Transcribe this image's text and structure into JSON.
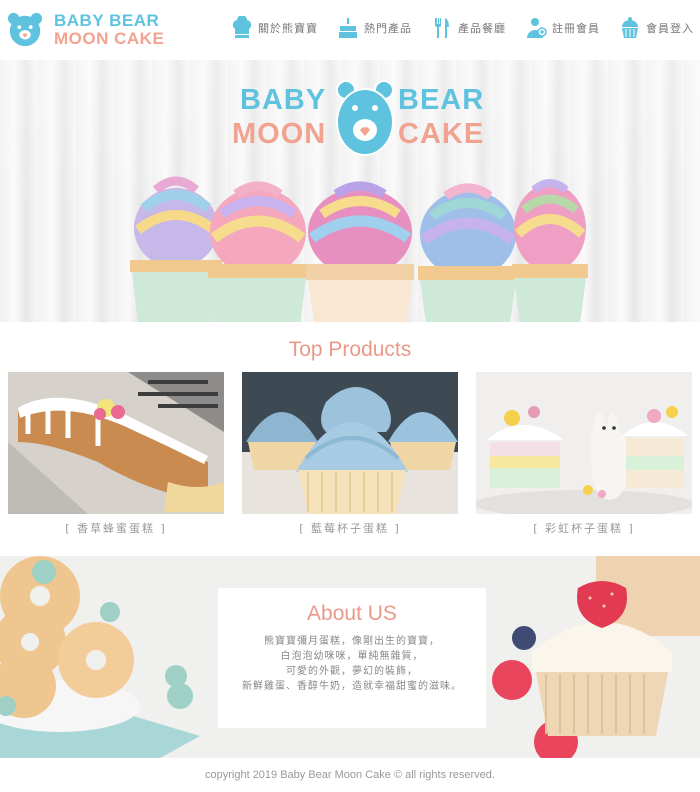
{
  "brand": {
    "line1": "BABY BEAR",
    "line2": "MOON CAKE",
    "hero_left_top": "BABY",
    "hero_right_top": "BEAR",
    "hero_left_bottom": "MOON",
    "hero_right_bottom": "CAKE",
    "color_blue": "#5fc3e0",
    "color_pink": "#f2a38f"
  },
  "nav": {
    "items": [
      {
        "label": "關於熊寶寶",
        "icon": "chef-hat-icon"
      },
      {
        "label": "熱門產品",
        "icon": "birthday-cake-icon"
      },
      {
        "label": "產品餐廳",
        "icon": "fork-knife-icon"
      },
      {
        "label": "註冊會員",
        "icon": "user-add-icon"
      },
      {
        "label": "會員登入",
        "icon": "cupcake-icon"
      }
    ]
  },
  "products": {
    "title": "Top Products",
    "items": [
      {
        "label": "[ 香草蜂蜜蛋糕 ]"
      },
      {
        "label": "[ 藍莓杯子蛋糕 ]"
      },
      {
        "label": "[ 彩虹杯子蛋糕 ]"
      }
    ]
  },
  "about": {
    "title": "About US",
    "lines": [
      "熊寶寶彌月蛋糕，像剛出生的寶寶，",
      "白泡泡幼咪咪，單純無雜質，",
      "可愛的外觀，夢幻的裝飾，",
      "新鮮雞蛋、香醇牛奶，造就幸福甜蜜的滋味。"
    ]
  },
  "footer": {
    "copyright": "copyright 2019 Baby Bear Moon Cake © all rights reserved."
  }
}
